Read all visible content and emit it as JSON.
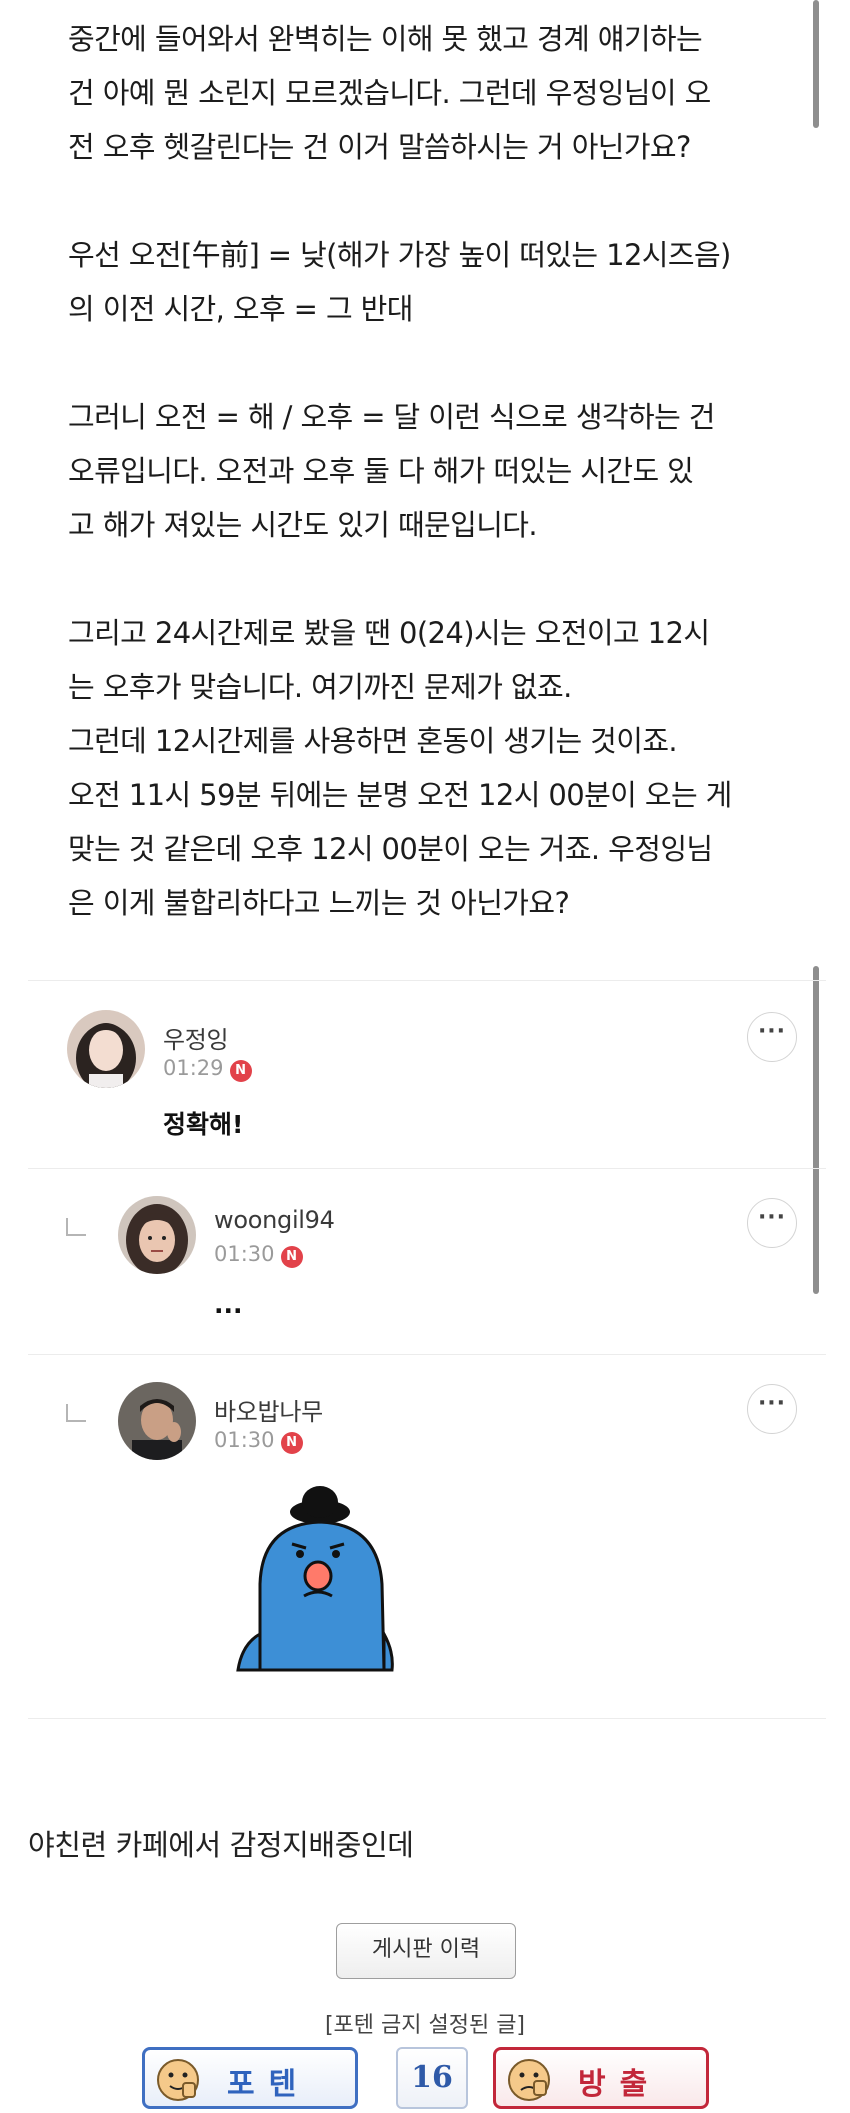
{
  "post": {
    "paragraphs": [
      [
        "중간에 들어와서 완벽히는 이해 못 했고 경계 얘기하는",
        "건 아예 뭔 소린지 모르겠습니다. 그런데 우정잉님이 오",
        "전 오후 헷갈린다는 건 이거 말씀하시는 거 아닌가요?"
      ],
      [
        "우선 오전[午前] = 낮(해가 가장 높이 떠있는 12시즈음)",
        "의 이전 시간, 오후 = 그 반대"
      ],
      [
        "그러니 오전 = 해 / 오후 = 달 이런 식으로 생각하는 건",
        "오류입니다. 오전과 오후 둘 다 해가 떠있는 시간도 있",
        "고 해가 져있는 시간도 있기 때문입니다."
      ],
      [
        "그리고 24시간제로 봤을 땐 0(24)시는 오전이고 12시",
        "는 오후가 맞습니다. 여기까진 문제가 없죠.",
        "그런데 12시간제를 사용하면 혼동이 생기는 것이죠.",
        "오전 11시 59분 뒤에는 분명 오전 12시 00분이 오는 게",
        "맞는 것 같은데 오후 12시 00분이 오는 거죠. 우정잉님",
        "은 이게 불합리하다고 느끼는 것 아닌가요?"
      ]
    ]
  },
  "comments": [
    {
      "author": "우정잉",
      "time": "01:29",
      "badge": "N",
      "text": "정확해!",
      "more": "···"
    },
    {
      "author": "woongil94",
      "time": "01:30",
      "badge": "N",
      "text": "...",
      "more": "···"
    },
    {
      "author": "바오밥나무",
      "time": "01:30",
      "badge": "N",
      "text": "",
      "more": "···"
    }
  ],
  "footer": {
    "cafe_text": "야친련 카페에서 감정지배중인데",
    "board_history_button": "게시판 이력",
    "forbid_note": "[포텐 금지 설정된 글]",
    "vote_positive_label": "포텐",
    "vote_count": "16",
    "vote_negative_label": "방출"
  },
  "colors": {
    "badge": "#e2424a",
    "vote_positive": "#2f63bd",
    "vote_negative": "#c2273a",
    "emoticon_body": "#3d8fd6"
  }
}
